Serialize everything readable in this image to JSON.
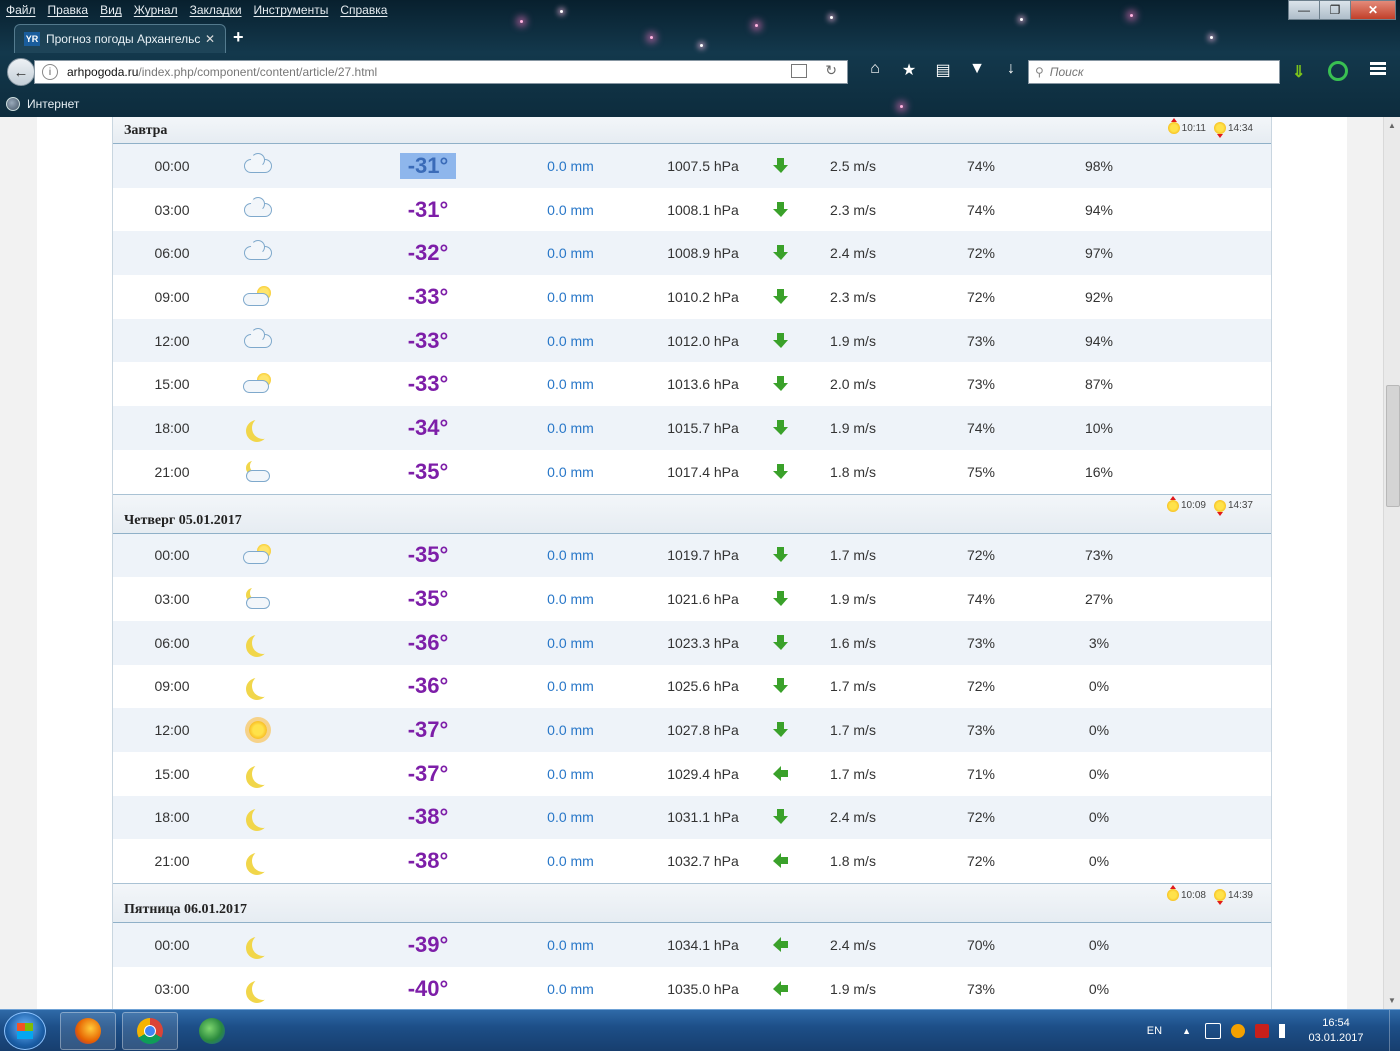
{
  "browser": {
    "menu": [
      "Файл",
      "Правка",
      "Вид",
      "Журнал",
      "Закладки",
      "Инструменты",
      "Справка"
    ],
    "tab": {
      "favicon": "YR",
      "title": "Прогноз погоды Архангельск"
    },
    "url_domain": "arhpogoda.ru",
    "url_path": "/index.php/component/content/article/27.html",
    "search_placeholder": "Поиск",
    "bookmark": "Интернет"
  },
  "days": [
    {
      "title": "Завтра",
      "sunrise": "10:11",
      "sunset": "14:34",
      "rows": [
        {
          "time": "00:00",
          "icon": "cloud-icon",
          "temp": "-31°",
          "precip": "0.0 mm",
          "pressure": "1007.5 hPa",
          "wind_dir": "down",
          "wind": "2.5 m/s",
          "humidity": "74%",
          "cloud": "98%"
        },
        {
          "time": "03:00",
          "icon": "cloud-icon",
          "temp": "-31°",
          "precip": "0.0 mm",
          "pressure": "1008.1 hPa",
          "wind_dir": "down",
          "wind": "2.3 m/s",
          "humidity": "74%",
          "cloud": "94%"
        },
        {
          "time": "06:00",
          "icon": "cloud-icon",
          "temp": "-32°",
          "precip": "0.0 mm",
          "pressure": "1008.9 hPa",
          "wind_dir": "down",
          "wind": "2.4 m/s",
          "humidity": "72%",
          "cloud": "97%"
        },
        {
          "time": "09:00",
          "icon": "partly-cloudy-icon",
          "temp": "-33°",
          "precip": "0.0 mm",
          "pressure": "1010.2 hPa",
          "wind_dir": "down",
          "wind": "2.3 m/s",
          "humidity": "72%",
          "cloud": "92%"
        },
        {
          "time": "12:00",
          "icon": "cloud-icon",
          "temp": "-33°",
          "precip": "0.0 mm",
          "pressure": "1012.0 hPa",
          "wind_dir": "down",
          "wind": "1.9 m/s",
          "humidity": "73%",
          "cloud": "94%"
        },
        {
          "time": "15:00",
          "icon": "partly-cloudy-icon",
          "temp": "-33°",
          "precip": "0.0 mm",
          "pressure": "1013.6 hPa",
          "wind_dir": "down",
          "wind": "2.0 m/s",
          "humidity": "73%",
          "cloud": "87%"
        },
        {
          "time": "18:00",
          "icon": "moon-icon",
          "temp": "-34°",
          "precip": "0.0 mm",
          "pressure": "1015.7 hPa",
          "wind_dir": "down",
          "wind": "1.9 m/s",
          "humidity": "74%",
          "cloud": "10%"
        },
        {
          "time": "21:00",
          "icon": "moon-cloud-icon",
          "temp": "-35°",
          "precip": "0.0 mm",
          "pressure": "1017.4 hPa",
          "wind_dir": "down",
          "wind": "1.8 m/s",
          "humidity": "75%",
          "cloud": "16%"
        }
      ]
    },
    {
      "title": "Четверг 05.01.2017",
      "sunrise": "10:09",
      "sunset": "14:37",
      "rows": [
        {
          "time": "00:00",
          "icon": "partly-cloudy-icon",
          "temp": "-35°",
          "precip": "0.0 mm",
          "pressure": "1019.7 hPa",
          "wind_dir": "down",
          "wind": "1.7 m/s",
          "humidity": "72%",
          "cloud": "73%"
        },
        {
          "time": "03:00",
          "icon": "moon-cloud-icon",
          "temp": "-35°",
          "precip": "0.0 mm",
          "pressure": "1021.6 hPa",
          "wind_dir": "down",
          "wind": "1.9 m/s",
          "humidity": "74%",
          "cloud": "27%"
        },
        {
          "time": "06:00",
          "icon": "moon-icon",
          "temp": "-36°",
          "precip": "0.0 mm",
          "pressure": "1023.3 hPa",
          "wind_dir": "down",
          "wind": "1.6 m/s",
          "humidity": "73%",
          "cloud": "3%"
        },
        {
          "time": "09:00",
          "icon": "moon-icon",
          "temp": "-36°",
          "precip": "0.0 mm",
          "pressure": "1025.6 hPa",
          "wind_dir": "down",
          "wind": "1.7 m/s",
          "humidity": "72%",
          "cloud": "0%"
        },
        {
          "time": "12:00",
          "icon": "sun-icon",
          "temp": "-37°",
          "precip": "0.0 mm",
          "pressure": "1027.8 hPa",
          "wind_dir": "down",
          "wind": "1.7 m/s",
          "humidity": "73%",
          "cloud": "0%"
        },
        {
          "time": "15:00",
          "icon": "moon-icon",
          "temp": "-37°",
          "precip": "0.0 mm",
          "pressure": "1029.4 hPa",
          "wind_dir": "left",
          "wind": "1.7 m/s",
          "humidity": "71%",
          "cloud": "0%"
        },
        {
          "time": "18:00",
          "icon": "moon-icon",
          "temp": "-38°",
          "precip": "0.0 mm",
          "pressure": "1031.1 hPa",
          "wind_dir": "down",
          "wind": "2.4 m/s",
          "humidity": "72%",
          "cloud": "0%"
        },
        {
          "time": "21:00",
          "icon": "moon-icon",
          "temp": "-38°",
          "precip": "0.0 mm",
          "pressure": "1032.7 hPa",
          "wind_dir": "left",
          "wind": "1.8 m/s",
          "humidity": "72%",
          "cloud": "0%"
        }
      ]
    },
    {
      "title": "Пятница 06.01.2017",
      "sunrise": "10:08",
      "sunset": "14:39",
      "rows": [
        {
          "time": "00:00",
          "icon": "moon-icon",
          "temp": "-39°",
          "precip": "0.0 mm",
          "pressure": "1034.1 hPa",
          "wind_dir": "left",
          "wind": "2.4 m/s",
          "humidity": "70%",
          "cloud": "0%"
        },
        {
          "time": "03:00",
          "icon": "moon-icon",
          "temp": "-40°",
          "precip": "0.0 mm",
          "pressure": "1035.0 hPa",
          "wind_dir": "left",
          "wind": "1.9 m/s",
          "humidity": "73%",
          "cloud": "0%"
        }
      ]
    }
  ],
  "taskbar": {
    "lang": "EN",
    "clock_time": "16:54",
    "clock_date": "03.01.2017"
  }
}
